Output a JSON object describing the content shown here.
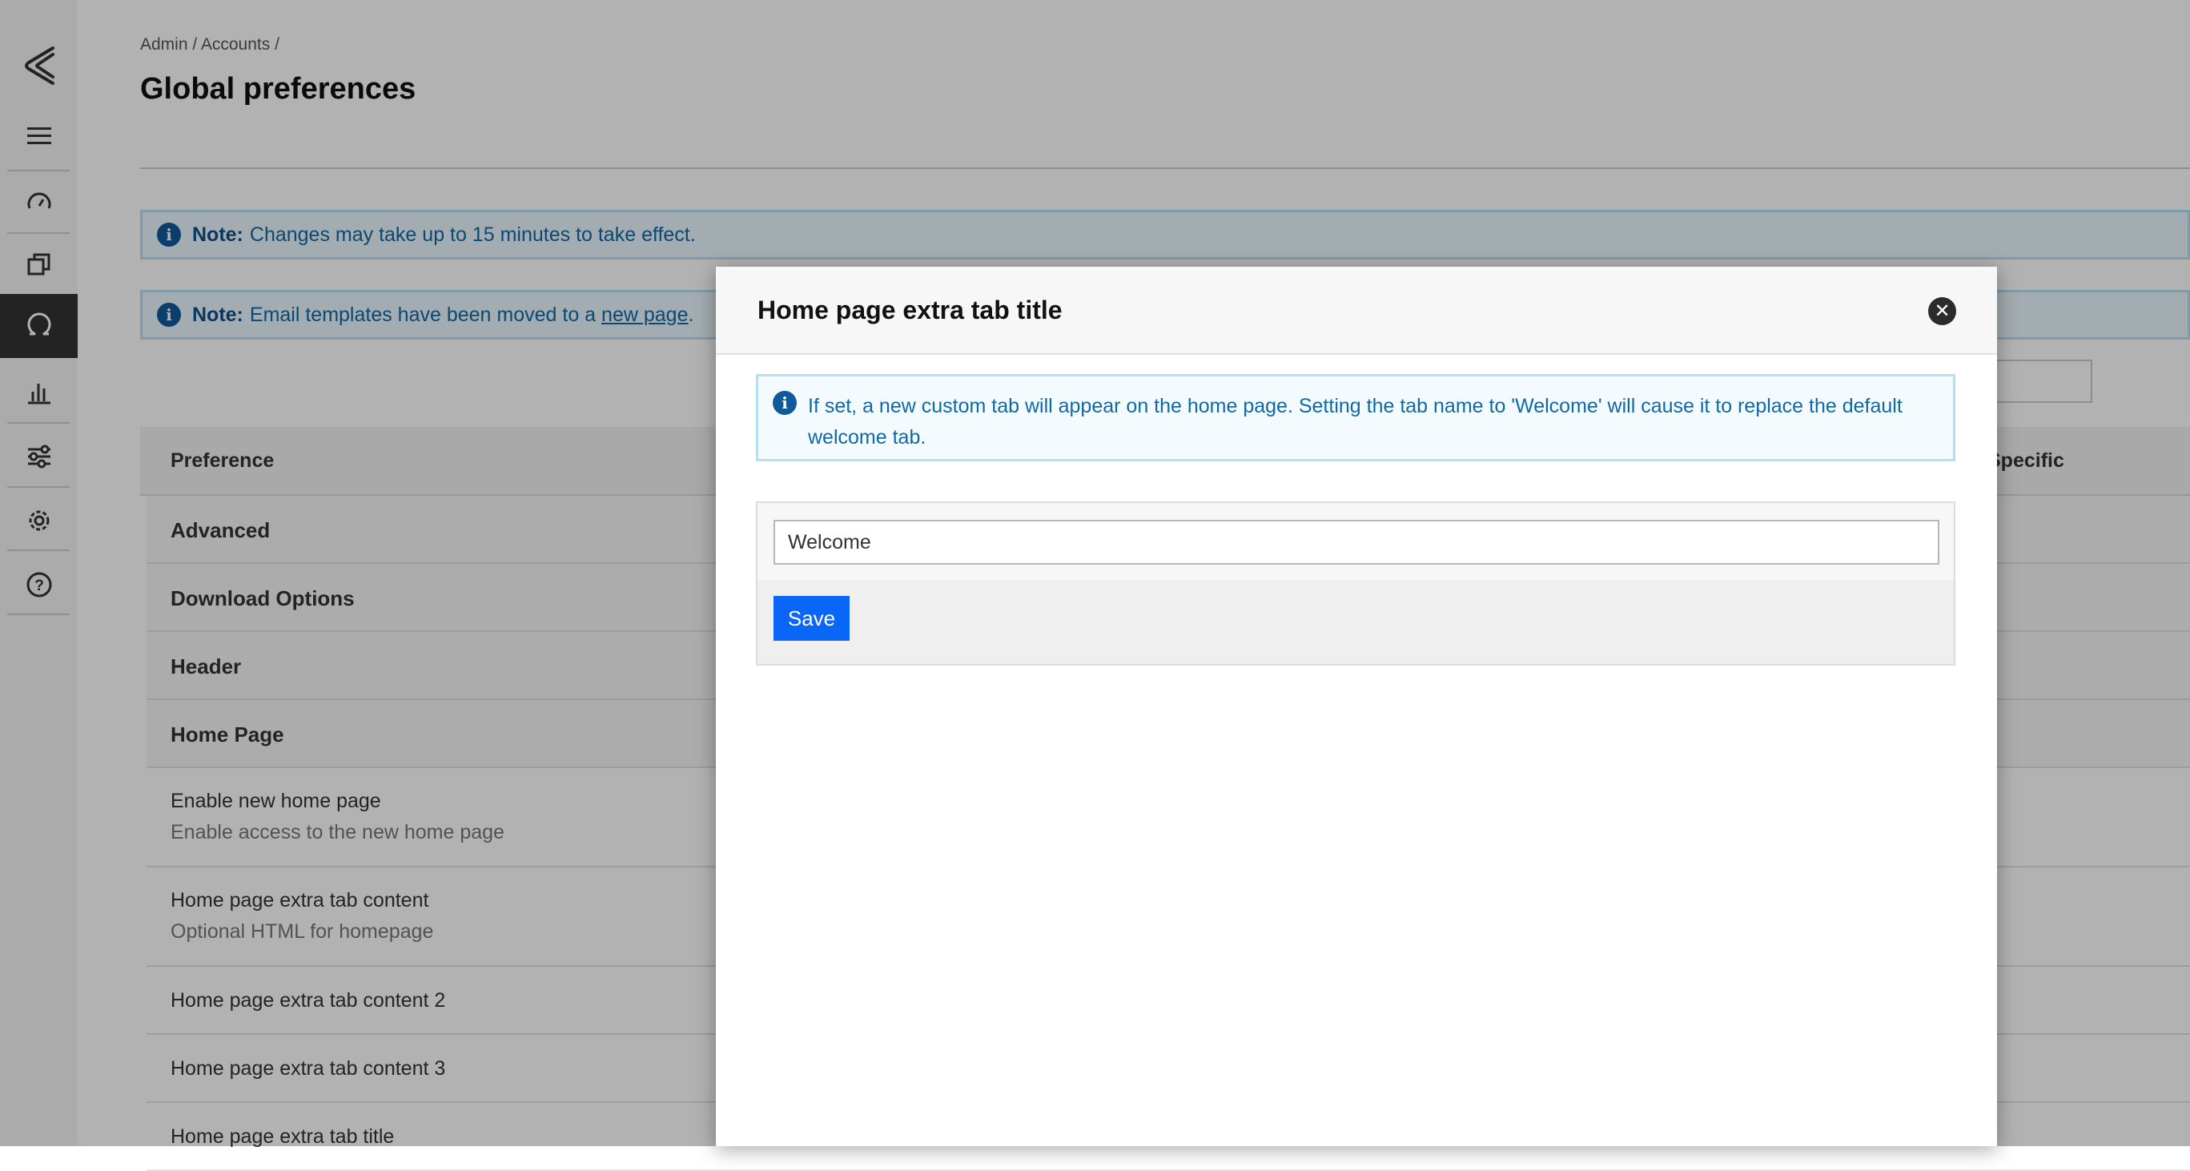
{
  "sidebar": {
    "items": [
      {
        "icon": "logo-icon"
      },
      {
        "icon": "menu-icon"
      },
      {
        "icon": "dashboard-gauge-icon"
      },
      {
        "icon": "windows-icon"
      },
      {
        "icon": "chat-bubble-icon",
        "active": true
      },
      {
        "icon": "bar-chart-icon"
      },
      {
        "icon": "sliders-icon"
      },
      {
        "icon": "gear-icon"
      },
      {
        "icon": "help-icon"
      }
    ]
  },
  "breadcrumb": "Admin / Accounts /",
  "page_title": "Global preferences",
  "notes": [
    {
      "label": "Note:",
      "text": "Changes may take up to 15 minutes to take effect."
    },
    {
      "label": "Note:",
      "text_before": "Email templates have been moved to a",
      "link": "new page",
      "text_after": "."
    }
  ],
  "table": {
    "headers": {
      "preference": "Preference",
      "specific": "Specific"
    },
    "groups": [
      "Advanced",
      "Download Options",
      "Header",
      "Home Page"
    ],
    "rows": [
      {
        "title": "Enable new home page",
        "desc": "Enable access to the new home page"
      },
      {
        "title": "Home page extra tab content",
        "desc": "Optional HTML for homepage"
      },
      {
        "title": "Home page extra tab content 2"
      },
      {
        "title": "Home page extra tab content 3"
      },
      {
        "title": "Home page extra tab title"
      }
    ]
  },
  "modal": {
    "title": "Home page extra tab title",
    "close_symbol": "✕",
    "info": "If set, a new custom tab will appear on the home page. Setting the tab name to 'Welcome' will cause it to replace the default welcome tab.",
    "input_value": "Welcome",
    "save_label": "Save"
  },
  "colors": {
    "accent": "#0a66f7",
    "info_text": "#1168a6",
    "sidebar_active": "#333333"
  }
}
